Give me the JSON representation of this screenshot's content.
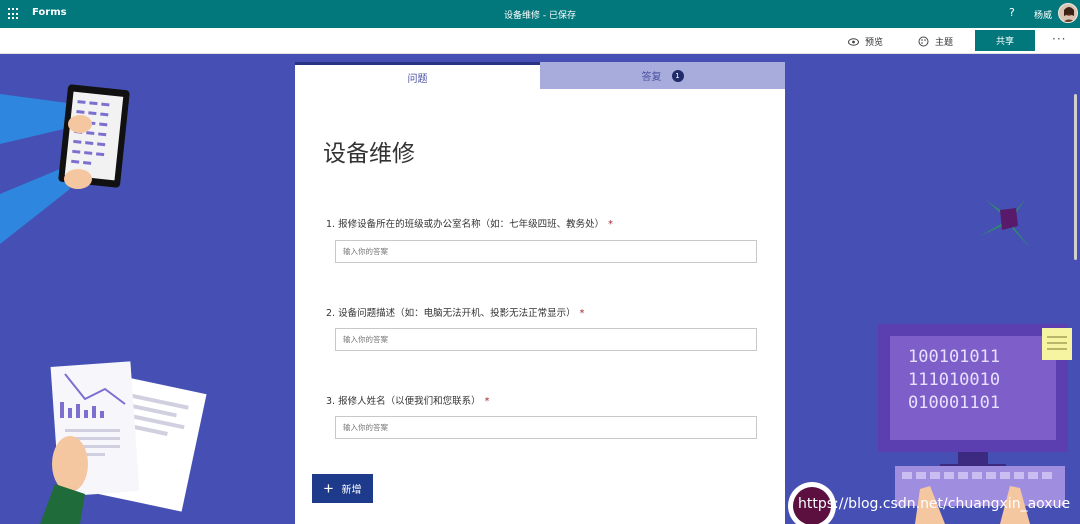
{
  "topbar": {
    "app_name": "Forms",
    "doc_title": "设备维修 - 已保存",
    "help": "?",
    "user_name": "杨威"
  },
  "cmdbar": {
    "preview_label": "预览",
    "theme_label": "主题",
    "share_label": "共享",
    "more": "···"
  },
  "tabs": {
    "questions": "问题",
    "responses": "答复",
    "response_count": "1"
  },
  "form": {
    "title": "设备维修",
    "questions": [
      {
        "label": "1. 报修设备所在的班级或办公室名称（如：七年级四班、教务处）",
        "required": "*",
        "placeholder": "输入你的答案"
      },
      {
        "label": "2. 设备问题描述（如：电脑无法开机、投影无法正常显示）",
        "required": "*",
        "placeholder": "输入你的答案"
      },
      {
        "label": "3. 报修人姓名（以便我们和您联系）",
        "required": "*",
        "placeholder": "输入你的答案"
      }
    ],
    "add_label": "新增"
  },
  "illustration": {
    "binary_lines": [
      "100101011",
      "111010010",
      "010001101"
    ]
  },
  "watermark": "https://blog.csdn.net/chuangxin_aoxue",
  "colors": {
    "topbar": "#03787c",
    "background": "#4650b4",
    "tab_active_border": "#2a3283",
    "add_button": "#1e3a8a",
    "required": "#a4262c"
  }
}
